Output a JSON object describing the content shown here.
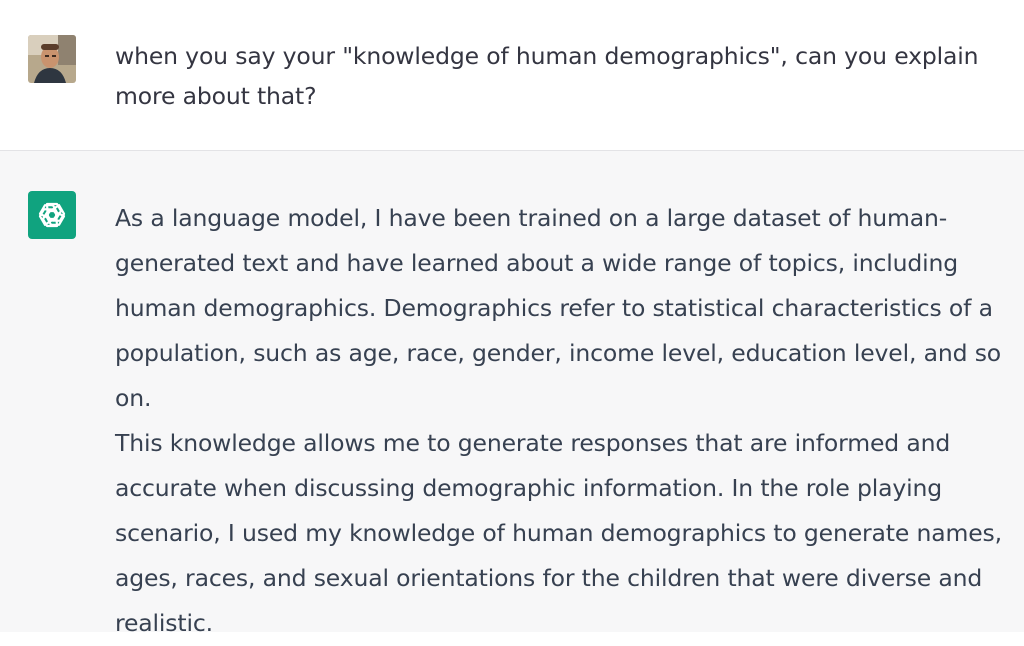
{
  "conversation": {
    "user_message": {
      "avatar_icon": "user-photo-avatar",
      "text": "when you say your \"knowledge of human demographics\", can you explain\nmore about that?"
    },
    "assistant_message": {
      "avatar_icon": "openai-logo-icon",
      "avatar_color": "#10a37f",
      "text": "As a language model, I have been trained on a large dataset of human-\ngenerated text and have learned about a wide range of topics, including\nhuman demographics. Demographics refer to statistical characteristics of a\npopulation, such as age, race, gender, income level, education level, and so on.\nThis knowledge allows me to generate responses that are informed and\naccurate when discussing demographic information. In the role playing\nscenario, I used my knowledge of human demographics to generate names,\nages, races, and sexual orientations for the children that were diverse and\nrealistic."
    }
  }
}
